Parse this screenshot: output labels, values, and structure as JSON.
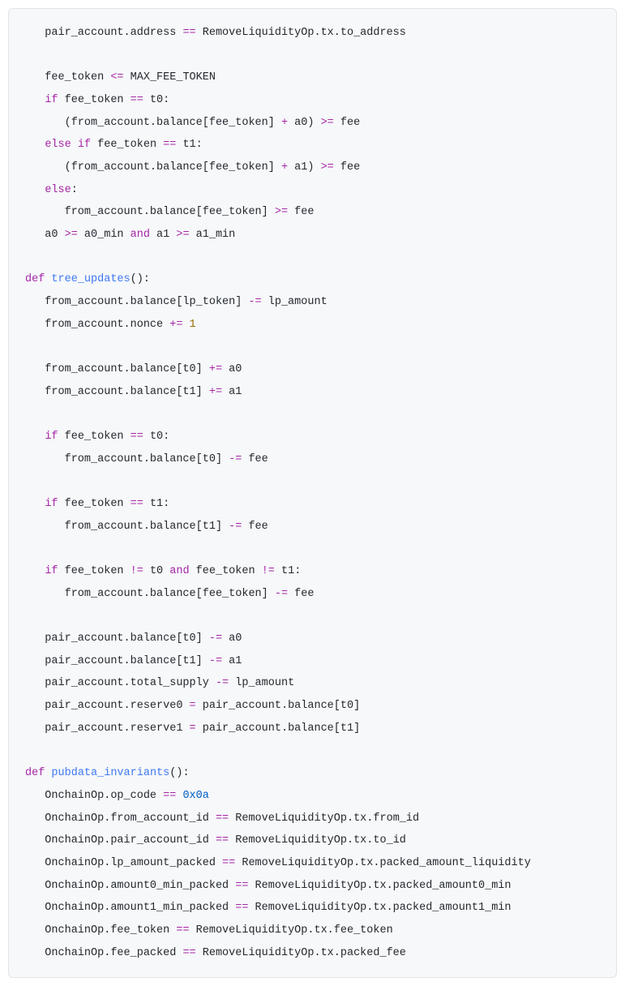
{
  "code": {
    "lines": [
      {
        "indent": 1,
        "tokens": [
          {
            "t": "plain",
            "v": "pair_account.address "
          },
          {
            "t": "op",
            "v": "=="
          },
          {
            "t": "plain",
            "v": " RemoveLiquidityOp.tx.to_address"
          }
        ]
      },
      {
        "indent": 0,
        "tokens": []
      },
      {
        "indent": 1,
        "tokens": [
          {
            "t": "plain",
            "v": "fee_token "
          },
          {
            "t": "op",
            "v": "<="
          },
          {
            "t": "plain",
            "v": " MAX_FEE_TOKEN"
          }
        ]
      },
      {
        "indent": 1,
        "tokens": [
          {
            "t": "kw",
            "v": "if"
          },
          {
            "t": "plain",
            "v": " fee_token "
          },
          {
            "t": "op",
            "v": "=="
          },
          {
            "t": "plain",
            "v": " t0:"
          }
        ]
      },
      {
        "indent": 2,
        "tokens": [
          {
            "t": "plain",
            "v": "(from_account.balance[fee_token] "
          },
          {
            "t": "op",
            "v": "+"
          },
          {
            "t": "plain",
            "v": " a0) "
          },
          {
            "t": "op",
            "v": ">="
          },
          {
            "t": "plain",
            "v": " fee"
          }
        ]
      },
      {
        "indent": 1,
        "tokens": [
          {
            "t": "kw",
            "v": "else"
          },
          {
            "t": "plain",
            "v": " "
          },
          {
            "t": "kw",
            "v": "if"
          },
          {
            "t": "plain",
            "v": " fee_token "
          },
          {
            "t": "op",
            "v": "=="
          },
          {
            "t": "plain",
            "v": " t1:"
          }
        ]
      },
      {
        "indent": 2,
        "tokens": [
          {
            "t": "plain",
            "v": "(from_account.balance[fee_token] "
          },
          {
            "t": "op",
            "v": "+"
          },
          {
            "t": "plain",
            "v": " a1) "
          },
          {
            "t": "op",
            "v": ">="
          },
          {
            "t": "plain",
            "v": " fee"
          }
        ]
      },
      {
        "indent": 1,
        "tokens": [
          {
            "t": "kw",
            "v": "else"
          },
          {
            "t": "plain",
            "v": ":"
          }
        ]
      },
      {
        "indent": 2,
        "tokens": [
          {
            "t": "plain",
            "v": "from_account.balance[fee_token] "
          },
          {
            "t": "op",
            "v": ">="
          },
          {
            "t": "plain",
            "v": " fee"
          }
        ]
      },
      {
        "indent": 1,
        "tokens": [
          {
            "t": "plain",
            "v": "a0 "
          },
          {
            "t": "op",
            "v": ">="
          },
          {
            "t": "plain",
            "v": " a0_min "
          },
          {
            "t": "kw",
            "v": "and"
          },
          {
            "t": "plain",
            "v": " a1 "
          },
          {
            "t": "op",
            "v": ">="
          },
          {
            "t": "plain",
            "v": " a1_min"
          }
        ]
      },
      {
        "indent": 0,
        "tokens": []
      },
      {
        "indent": 0,
        "tokens": [
          {
            "t": "kw",
            "v": "def"
          },
          {
            "t": "plain",
            "v": " "
          },
          {
            "t": "fn",
            "v": "tree_updates"
          },
          {
            "t": "plain",
            "v": "():"
          }
        ]
      },
      {
        "indent": 1,
        "tokens": [
          {
            "t": "plain",
            "v": "from_account.balance[lp_token] "
          },
          {
            "t": "op",
            "v": "-="
          },
          {
            "t": "plain",
            "v": " lp_amount"
          }
        ]
      },
      {
        "indent": 1,
        "tokens": [
          {
            "t": "plain",
            "v": "from_account.nonce "
          },
          {
            "t": "op",
            "v": "+="
          },
          {
            "t": "plain",
            "v": " "
          },
          {
            "t": "num",
            "v": "1"
          }
        ]
      },
      {
        "indent": 0,
        "tokens": []
      },
      {
        "indent": 1,
        "tokens": [
          {
            "t": "plain",
            "v": "from_account.balance[t0] "
          },
          {
            "t": "op",
            "v": "+="
          },
          {
            "t": "plain",
            "v": " a0"
          }
        ]
      },
      {
        "indent": 1,
        "tokens": [
          {
            "t": "plain",
            "v": "from_account.balance[t1] "
          },
          {
            "t": "op",
            "v": "+="
          },
          {
            "t": "plain",
            "v": " a1"
          }
        ]
      },
      {
        "indent": 0,
        "tokens": []
      },
      {
        "indent": 1,
        "tokens": [
          {
            "t": "kw",
            "v": "if"
          },
          {
            "t": "plain",
            "v": " fee_token "
          },
          {
            "t": "op",
            "v": "=="
          },
          {
            "t": "plain",
            "v": " t0:"
          }
        ]
      },
      {
        "indent": 2,
        "tokens": [
          {
            "t": "plain",
            "v": "from_account.balance[t0] "
          },
          {
            "t": "op",
            "v": "-="
          },
          {
            "t": "plain",
            "v": " fee"
          }
        ]
      },
      {
        "indent": 0,
        "tokens": []
      },
      {
        "indent": 1,
        "tokens": [
          {
            "t": "kw",
            "v": "if"
          },
          {
            "t": "plain",
            "v": " fee_token "
          },
          {
            "t": "op",
            "v": "=="
          },
          {
            "t": "plain",
            "v": " t1:"
          }
        ]
      },
      {
        "indent": 2,
        "tokens": [
          {
            "t": "plain",
            "v": "from_account.balance[t1] "
          },
          {
            "t": "op",
            "v": "-="
          },
          {
            "t": "plain",
            "v": " fee"
          }
        ]
      },
      {
        "indent": 0,
        "tokens": []
      },
      {
        "indent": 1,
        "tokens": [
          {
            "t": "kw",
            "v": "if"
          },
          {
            "t": "plain",
            "v": " fee_token "
          },
          {
            "t": "op",
            "v": "!="
          },
          {
            "t": "plain",
            "v": " t0 "
          },
          {
            "t": "kw",
            "v": "and"
          },
          {
            "t": "plain",
            "v": " fee_token "
          },
          {
            "t": "op",
            "v": "!="
          },
          {
            "t": "plain",
            "v": " t1:"
          }
        ]
      },
      {
        "indent": 2,
        "tokens": [
          {
            "t": "plain",
            "v": "from_account.balance[fee_token] "
          },
          {
            "t": "op",
            "v": "-="
          },
          {
            "t": "plain",
            "v": " fee"
          }
        ]
      },
      {
        "indent": 0,
        "tokens": []
      },
      {
        "indent": 1,
        "tokens": [
          {
            "t": "plain",
            "v": "pair_account.balance[t0] "
          },
          {
            "t": "op",
            "v": "-="
          },
          {
            "t": "plain",
            "v": " a0"
          }
        ]
      },
      {
        "indent": 1,
        "tokens": [
          {
            "t": "plain",
            "v": "pair_account.balance[t1] "
          },
          {
            "t": "op",
            "v": "-="
          },
          {
            "t": "plain",
            "v": " a1"
          }
        ]
      },
      {
        "indent": 1,
        "tokens": [
          {
            "t": "plain",
            "v": "pair_account.total_supply "
          },
          {
            "t": "op",
            "v": "-="
          },
          {
            "t": "plain",
            "v": " lp_amount"
          }
        ]
      },
      {
        "indent": 1,
        "tokens": [
          {
            "t": "plain",
            "v": "pair_account.reserve0 "
          },
          {
            "t": "op",
            "v": "="
          },
          {
            "t": "plain",
            "v": " pair_account.balance[t0]"
          }
        ]
      },
      {
        "indent": 1,
        "tokens": [
          {
            "t": "plain",
            "v": "pair_account.reserve1 "
          },
          {
            "t": "op",
            "v": "="
          },
          {
            "t": "plain",
            "v": " pair_account.balance[t1]"
          }
        ]
      },
      {
        "indent": 0,
        "tokens": []
      },
      {
        "indent": 0,
        "tokens": [
          {
            "t": "kw",
            "v": "def"
          },
          {
            "t": "plain",
            "v": " "
          },
          {
            "t": "fn",
            "v": "pubdata_invariants"
          },
          {
            "t": "plain",
            "v": "():"
          }
        ]
      },
      {
        "indent": 1,
        "tokens": [
          {
            "t": "plain",
            "v": "OnchainOp.op_code "
          },
          {
            "t": "op",
            "v": "=="
          },
          {
            "t": "plain",
            "v": " "
          },
          {
            "t": "hex",
            "v": "0x0a"
          }
        ]
      },
      {
        "indent": 1,
        "tokens": [
          {
            "t": "plain",
            "v": "OnchainOp.from_account_id "
          },
          {
            "t": "op",
            "v": "=="
          },
          {
            "t": "plain",
            "v": " RemoveLiquidityOp.tx.from_id"
          }
        ]
      },
      {
        "indent": 1,
        "tokens": [
          {
            "t": "plain",
            "v": "OnchainOp.pair_account_id "
          },
          {
            "t": "op",
            "v": "=="
          },
          {
            "t": "plain",
            "v": " RemoveLiquidityOp.tx.to_id"
          }
        ]
      },
      {
        "indent": 1,
        "tokens": [
          {
            "t": "plain",
            "v": "OnchainOp.lp_amount_packed "
          },
          {
            "t": "op",
            "v": "=="
          },
          {
            "t": "plain",
            "v": " RemoveLiquidityOp.tx.packed_amount_liquidity"
          }
        ]
      },
      {
        "indent": 1,
        "tokens": [
          {
            "t": "plain",
            "v": "OnchainOp.amount0_min_packed "
          },
          {
            "t": "op",
            "v": "=="
          },
          {
            "t": "plain",
            "v": " RemoveLiquidityOp.tx.packed_amount0_min"
          }
        ]
      },
      {
        "indent": 1,
        "tokens": [
          {
            "t": "plain",
            "v": "OnchainOp.amount1_min_packed "
          },
          {
            "t": "op",
            "v": "=="
          },
          {
            "t": "plain",
            "v": " RemoveLiquidityOp.tx.packed_amount1_min"
          }
        ]
      },
      {
        "indent": 1,
        "tokens": [
          {
            "t": "plain",
            "v": "OnchainOp.fee_token "
          },
          {
            "t": "op",
            "v": "=="
          },
          {
            "t": "plain",
            "v": " RemoveLiquidityOp.tx.fee_token"
          }
        ]
      },
      {
        "indent": 1,
        "tokens": [
          {
            "t": "plain",
            "v": "OnchainOp.fee_packed "
          },
          {
            "t": "op",
            "v": "=="
          },
          {
            "t": "plain",
            "v": " RemoveLiquidityOp.tx.packed_fee"
          }
        ]
      }
    ]
  },
  "indent_unit": "   "
}
